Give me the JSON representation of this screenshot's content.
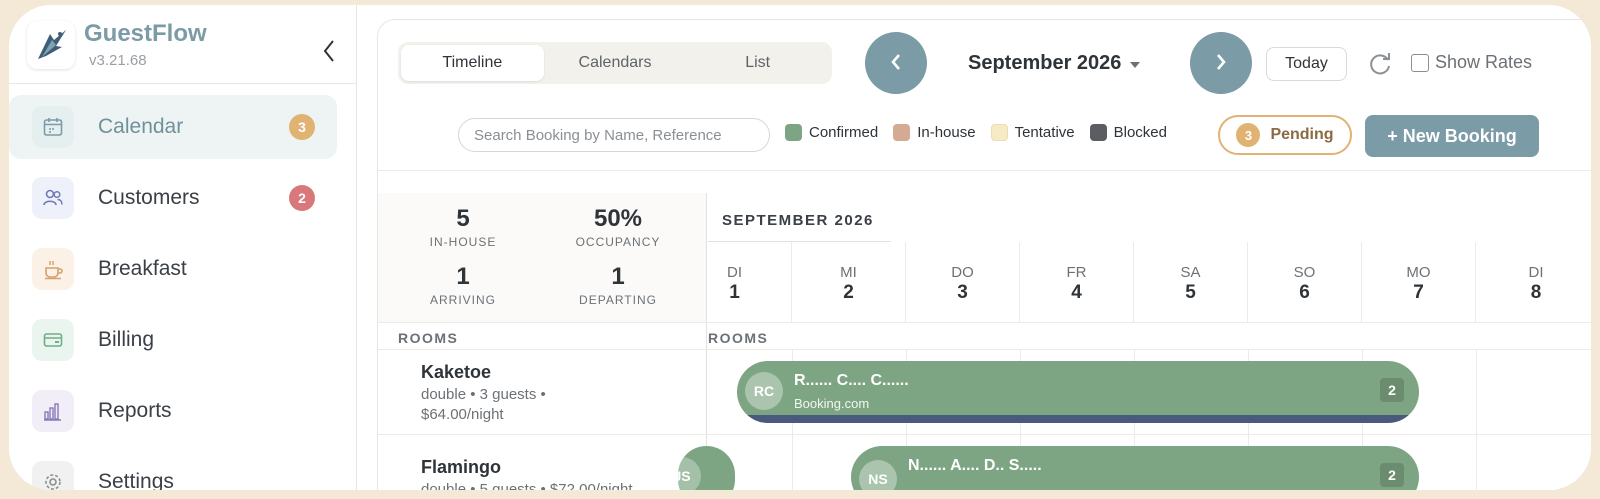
{
  "sidebar": {
    "brand_name": "GuestFlow",
    "version": "v3.21.68",
    "items": [
      {
        "label": "Calendar",
        "badge": "3",
        "badge_color": "#e0b372",
        "icon": "calendar-icon",
        "icon_bg": "#e6efef",
        "active": true
      },
      {
        "label": "Customers",
        "badge": "2",
        "badge_color": "#d9787a",
        "icon": "users-icon",
        "icon_bg": "#eef0fa",
        "active": false
      },
      {
        "label": "Breakfast",
        "badge": "",
        "icon": "coffee-icon",
        "icon_bg": "#fbf1e6",
        "active": false
      },
      {
        "label": "Billing",
        "badge": "",
        "icon": "credit-card-icon",
        "icon_bg": "#e9f5ee",
        "active": false
      },
      {
        "label": "Reports",
        "badge": "",
        "icon": "bar-chart-icon",
        "icon_bg": "#f1eef8",
        "active": false
      },
      {
        "label": "Settings",
        "badge": "",
        "icon": "gear-icon",
        "icon_bg": "#f1f1f1",
        "active": false
      }
    ]
  },
  "toolbar": {
    "tabs": [
      "Timeline",
      "Calendars",
      "List"
    ],
    "active_tab": "Timeline",
    "month": "September 2026",
    "today_label": "Today",
    "show_rates_label": "Show Rates",
    "search_placeholder": "Search Booking by Name, Reference",
    "legend": [
      {
        "label": "Confirmed",
        "color": "#7ea583"
      },
      {
        "label": "In-house",
        "color": "#d4aa93"
      },
      {
        "label": "Tentative",
        "color": "#f7ebc5"
      },
      {
        "label": "Blocked",
        "color": "#5a5d62"
      }
    ],
    "pending_count": "3",
    "pending_label": "Pending",
    "new_booking_label": "+ New Booking"
  },
  "stats": {
    "in_house": {
      "value": "5",
      "label": "IN-HOUSE"
    },
    "occupancy": {
      "value": "50%",
      "label": "OCCUPANCY"
    },
    "arriving": {
      "value": "1",
      "label": "ARRIVING"
    },
    "departing": {
      "value": "1",
      "label": "DEPARTING"
    }
  },
  "calendar": {
    "month_label": "SEPTEMBER 2026",
    "rooms_header": "ROOMS",
    "days": [
      {
        "name": "DI",
        "num": "1"
      },
      {
        "name": "MI",
        "num": "2"
      },
      {
        "name": "DO",
        "num": "3"
      },
      {
        "name": "FR",
        "num": "4"
      },
      {
        "name": "SA",
        "num": "5"
      },
      {
        "name": "SO",
        "num": "6"
      },
      {
        "name": "MO",
        "num": "7"
      },
      {
        "name": "DI",
        "num": "8"
      }
    ]
  },
  "rooms": [
    {
      "name": "Kaketoe",
      "detail": "double • 3 guests • $64.00/night"
    },
    {
      "name": "Flamingo",
      "detail": "double • 5 guests • $72.00/night"
    }
  ],
  "bookings": [
    {
      "initials": "RC",
      "name": "R...... C.... C......",
      "source": "Booking.com",
      "count": "2"
    },
    {
      "initials": "NS",
      "name": "N...... A.... D.. S.....",
      "source": "",
      "count": "2"
    },
    {
      "initials": "JS",
      "name": "",
      "source": "",
      "count": ""
    }
  ]
}
